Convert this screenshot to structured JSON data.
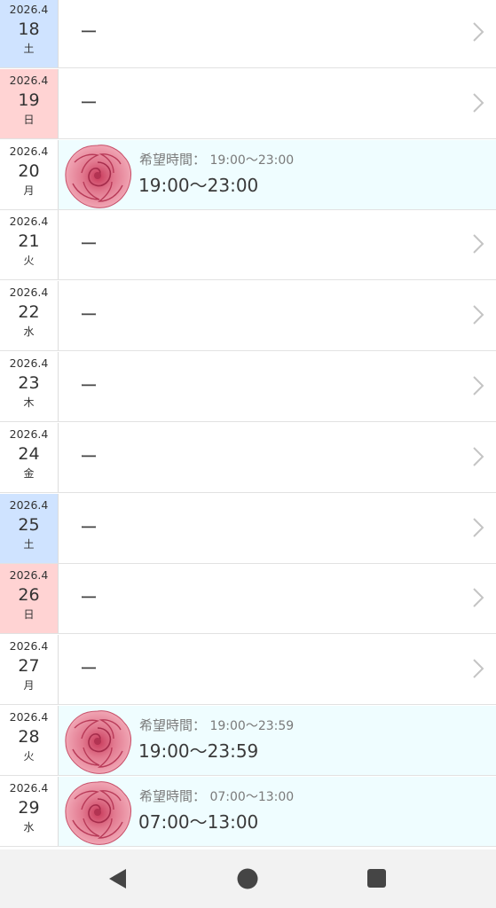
{
  "rows": [
    {
      "ym": "2026.4",
      "day": "18",
      "dow": "土",
      "type": "sat",
      "empty_text": "ー"
    },
    {
      "ym": "2026.4",
      "day": "19",
      "dow": "日",
      "type": "sun",
      "empty_text": "ー"
    },
    {
      "ym": "2026.4",
      "day": "20",
      "dow": "月",
      "type": "weekday",
      "hope_label": "希望時間：",
      "hope_time": "19:00〜23:00",
      "shift": "19:00〜23:00"
    },
    {
      "ym": "2026.4",
      "day": "21",
      "dow": "火",
      "type": "weekday",
      "empty_text": "ー"
    },
    {
      "ym": "2026.4",
      "day": "22",
      "dow": "水",
      "type": "weekday",
      "empty_text": "ー"
    },
    {
      "ym": "2026.4",
      "day": "23",
      "dow": "木",
      "type": "weekday",
      "empty_text": "ー"
    },
    {
      "ym": "2026.4",
      "day": "24",
      "dow": "金",
      "type": "weekday",
      "empty_text": "ー"
    },
    {
      "ym": "2026.4",
      "day": "25",
      "dow": "土",
      "type": "sat",
      "empty_text": "ー"
    },
    {
      "ym": "2026.4",
      "day": "26",
      "dow": "日",
      "type": "sun",
      "empty_text": "ー"
    },
    {
      "ym": "2026.4",
      "day": "27",
      "dow": "月",
      "type": "weekday",
      "empty_text": "ー"
    },
    {
      "ym": "2026.4",
      "day": "28",
      "dow": "火",
      "type": "weekday",
      "hope_label": "希望時間：",
      "hope_time": "19:00〜23:59",
      "shift": "19:00〜23:59"
    },
    {
      "ym": "2026.4",
      "day": "29",
      "dow": "水",
      "type": "weekday",
      "hope_label": "希望時間：",
      "hope_time": "07:00〜13:00",
      "shift": "07:00〜13:00"
    }
  ],
  "colors": {
    "saturday": "#cfe3ff",
    "sunday": "#ffd3d3",
    "shift_row": "#effdff",
    "navbar": "#f2f2f2",
    "nav_icon": "#454545"
  },
  "icons": {
    "row_chevron": "chevron-right-icon",
    "shift_avatar": "rose-icon",
    "nav_back": "back-triangle-icon",
    "nav_home": "home-circle-icon",
    "nav_recents": "recents-square-icon"
  }
}
